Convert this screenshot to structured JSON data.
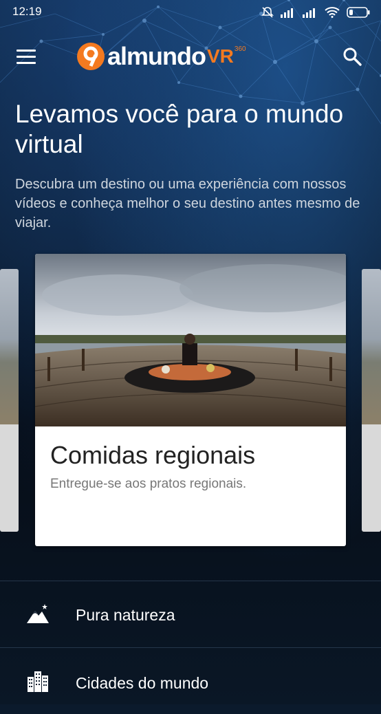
{
  "status_bar": {
    "time": "12:19",
    "icons": [
      "mute-icon",
      "signal-icon",
      "signal-icon",
      "wifi-icon",
      "battery-icon"
    ]
  },
  "header": {
    "menu_icon": "hamburger-icon",
    "logo_text": "almundo",
    "logo_vr": "VR",
    "logo_360": "360",
    "search_icon": "search-icon"
  },
  "hero": {
    "headline": "Levamos você para o mundo virtual",
    "subtitle": "Descubra um destino ou uma experiência com nossos vídeos e conheça melhor o seu destino antes mesmo de viajar."
  },
  "carousel": {
    "active_card": {
      "title": "Comidas regionais",
      "description": "Entregue-se aos pratos regionais."
    }
  },
  "categories": [
    {
      "label": "Pura natureza",
      "icon": "mountain-icon"
    },
    {
      "label": "Cidades do mundo",
      "icon": "city-buildings-icon"
    }
  ],
  "colors": {
    "brand_orange": "#f47a20",
    "background_dark": "#0b1a2c",
    "card_bg": "#ffffff"
  }
}
